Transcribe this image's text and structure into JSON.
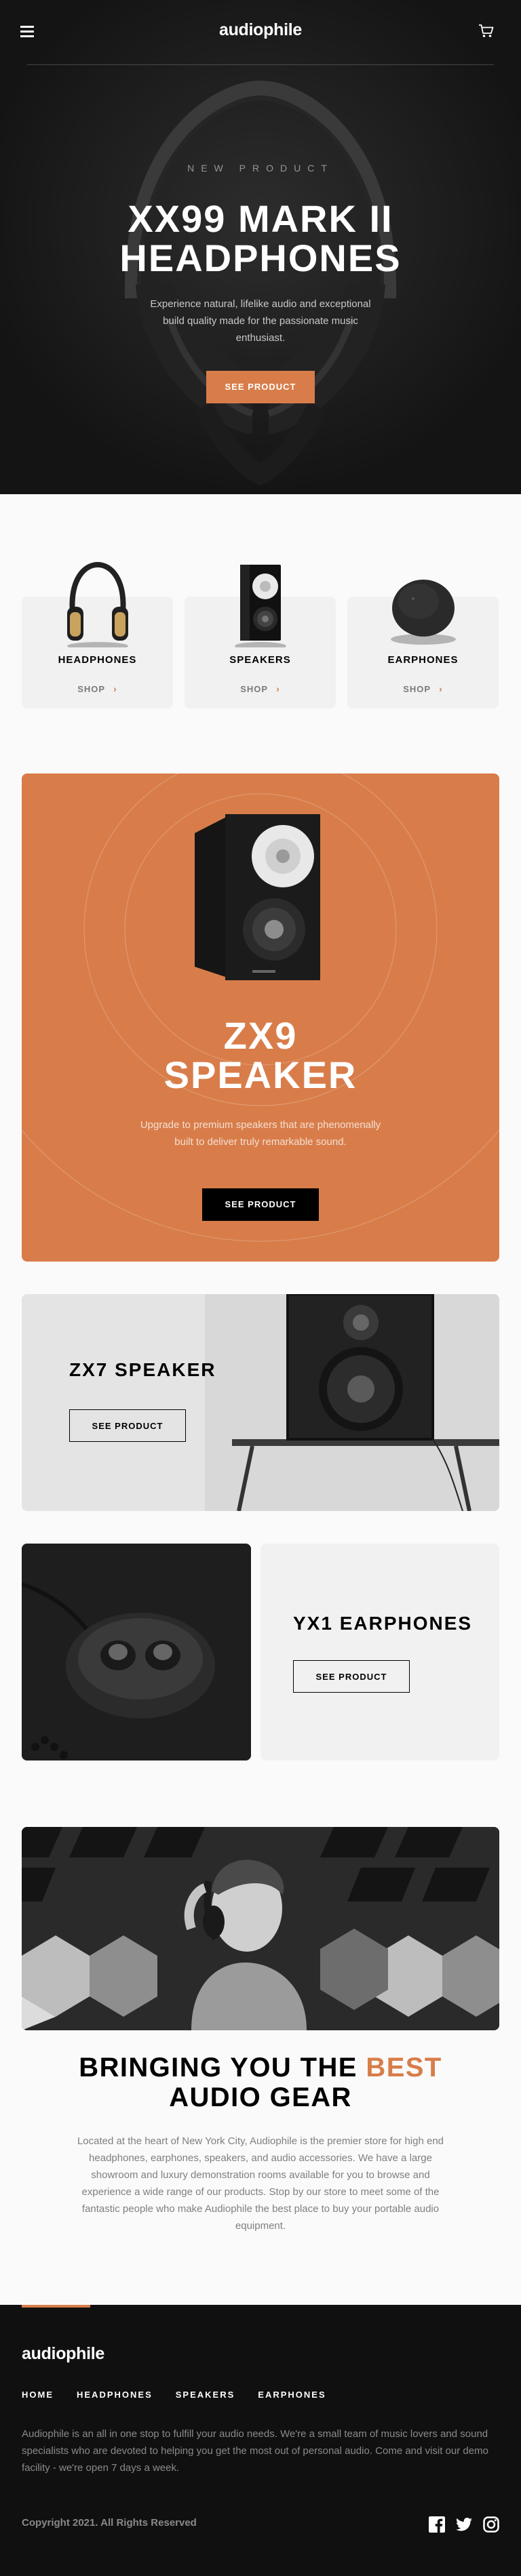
{
  "header": {
    "logo": "audiophile",
    "menu_icon": "hamburger-menu-icon",
    "cart_icon": "shopping-cart-icon"
  },
  "hero": {
    "overline": "NEW PRODUCT",
    "title_line1": "XX99 MARK II",
    "title_line2": "HEADPHONES",
    "text": "Experience natural, lifelike audio and exceptional build quality made for the passionate music enthusiast.",
    "button": "SEE PRODUCT"
  },
  "categories": [
    {
      "name": "HEADPHONES",
      "shop": "SHOP"
    },
    {
      "name": "SPEAKERS",
      "shop": "SHOP"
    },
    {
      "name": "EARPHONES",
      "shop": "SHOP"
    }
  ],
  "zx9": {
    "title_line1": "ZX9",
    "title_line2": "SPEAKER",
    "text": "Upgrade to premium speakers that are phenomenally built to deliver truly remarkable sound.",
    "button": "SEE PRODUCT"
  },
  "zx7": {
    "title": "ZX7 SPEAKER",
    "button": "SEE PRODUCT"
  },
  "yx1": {
    "title": "YX1 EARPHONES",
    "button": "SEE PRODUCT"
  },
  "about": {
    "title_part1": "BRINGING YOU THE",
    "title_accent": "BEST",
    "title_part2": "AUDIO GEAR",
    "text": "Located at the heart of New York City, Audiophile is the premier store for high end headphones, earphones, speakers, and audio accessories. We have a large showroom and luxury demonstration rooms available for you to browse and experience a wide range of our products. Stop by our store to meet some of the fantastic people who make Audiophile the best place to buy your portable audio equipment."
  },
  "footer": {
    "logo": "audiophile",
    "nav": [
      "HOME",
      "HEADPHONES",
      "SPEAKERS",
      "EARPHONES"
    ],
    "text": "Audiophile is an all in one stop to fulfill your audio needs. We're a small team of music lovers and sound specialists who are devoted to helping you get the most out of personal audio. Come and visit our demo facility - we're open 7 days a week.",
    "copyright": "Copyright 2021. All Rights Reserved",
    "social_icons": [
      "facebook-icon",
      "twitter-icon",
      "instagram-icon"
    ]
  },
  "colors": {
    "accent": "#d87d4a",
    "dark": "#191919",
    "light_gray": "#f1f1f1",
    "background": "#fafafa",
    "footer": "#101010"
  }
}
